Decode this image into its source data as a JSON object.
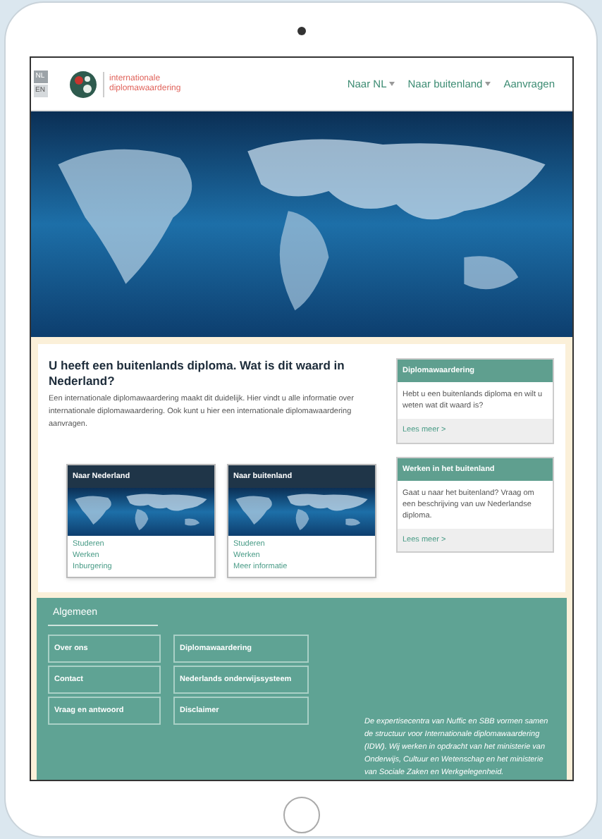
{
  "languages": [
    {
      "label": "NL",
      "selected": true
    },
    {
      "label": "EN",
      "selected": false
    }
  ],
  "logo": {
    "text_line_1": "internationale",
    "text_line_2": "diplomawaardering"
  },
  "nav": [
    {
      "label": "Naar NL",
      "dropdown": true
    },
    {
      "label": "Naar buitenland",
      "dropdown": true
    },
    {
      "label": "Aanvragen",
      "dropdown": false
    }
  ],
  "intro": {
    "heading": "U heeft een buitenlands diploma. Wat is dit waard in Nederland?",
    "text": "Een internationale diplomawaardering maakt dit duidelijk. Hier vindt u alle informatie over internationale diplomawaardering. Ook kunt u hier een internationale diplomawaardering aanvragen."
  },
  "cards": [
    {
      "title": "Naar Nederland",
      "links": [
        "Studeren",
        "Werken",
        "Inburgering"
      ]
    },
    {
      "title": "Naar buitenland",
      "links": [
        "Studeren",
        "Werken",
        "Meer informatie"
      ]
    }
  ],
  "side_panels": [
    {
      "title": "Diplomawaardering",
      "text": "Hebt u een buitenlands diploma en wilt u weten wat dit waard is?",
      "link": "Lees meer >"
    },
    {
      "title": "Werken in het buitenland",
      "text": "Gaat u naar het buitenland? Vraag om een beschrijving van uw Nederlandse diploma.",
      "link": "Lees meer >"
    }
  ],
  "footer": {
    "heading": "Algemeen",
    "links": [
      "Over ons",
      "Diplomawaardering",
      "Contact",
      "Nederlands onderwijssysteem",
      "Vraag en antwoord",
      "Disclaimer"
    ],
    "note": "De expertisecentra van Nuffic en SBB vormen samen de structuur voor Internationale diplomawaardering (IDW). Wij werken in opdracht van het ministerie van Onderwijs, Cultuur en Wetenschap en het ministerie van Sociale Zaken en Werkgelegenheid."
  }
}
